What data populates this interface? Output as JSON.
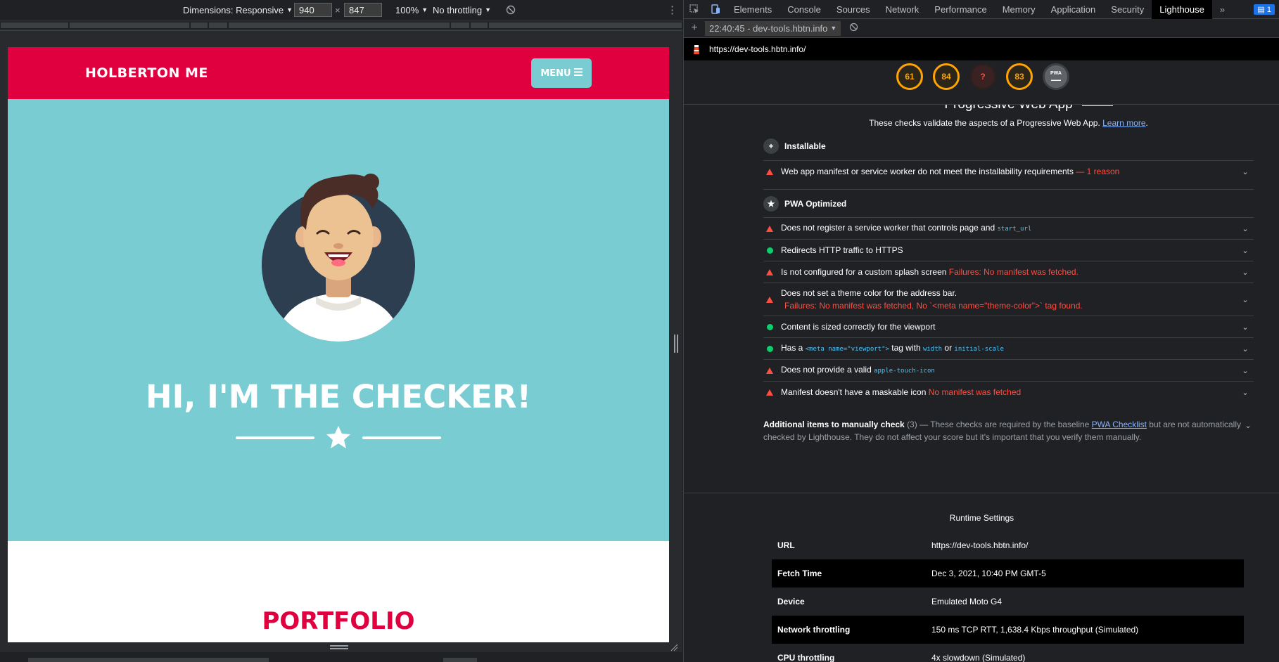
{
  "device_toolbar": {
    "dimensions_label": "Dimensions: Responsive",
    "width": "940",
    "height": "847",
    "times": "×",
    "zoom": "100%",
    "throttling": "No throttling"
  },
  "site": {
    "brand": "HOLBERTON ME",
    "menu_label": "MENU",
    "hero_title": "HI, I'M THE CHECKER!",
    "section_title": "PORTFOLIO"
  },
  "devtools": {
    "tabs": [
      "Elements",
      "Console",
      "Sources",
      "Network",
      "Performance",
      "Memory",
      "Application",
      "Security",
      "Lighthouse"
    ],
    "active_tab": "Lighthouse",
    "issues_count": "1",
    "report_selector": "22:40:45 - dev-tools.hbtn.info",
    "url": "https://dev-tools.hbtn.info/"
  },
  "scores": [
    {
      "label": "61",
      "kind": "average"
    },
    {
      "label": "84",
      "kind": "average"
    },
    {
      "label": "?",
      "kind": "error"
    },
    {
      "label": "83",
      "kind": "average"
    },
    {
      "label": "PWA",
      "kind": "pwa"
    }
  ],
  "pwa": {
    "title": "Progressive Web App",
    "description": "These checks validate the aspects of a Progressive Web App.",
    "learn_more": "Learn more",
    "installable": {
      "title": "Installable",
      "audits": [
        {
          "status": "fail",
          "text": "Web app manifest or service worker do not meet the installability requirements",
          "extra": "— 1 reason"
        }
      ]
    },
    "optimized": {
      "title": "PWA Optimized",
      "audits": [
        {
          "status": "fail",
          "text": "Does not register a service worker that controls page and",
          "code": "start_url"
        },
        {
          "status": "pass",
          "text": "Redirects HTTP traffic to HTTPS"
        },
        {
          "status": "fail",
          "text": "Is not configured for a custom splash screen",
          "extra": "Failures: No manifest was fetched."
        },
        {
          "status": "fail",
          "text": "Does not set a theme color for the address bar.",
          "extra": "Failures: No manifest was fetched, No `<meta name=\"theme-color\">` tag found."
        },
        {
          "status": "pass",
          "text": "Content is sized correctly for the viewport"
        },
        {
          "status": "pass",
          "text_a": "Has a",
          "code_a": "<meta name=\"viewport\">",
          "text_b": "tag with",
          "code_b": "width",
          "text_c": "or",
          "code_c": "initial-scale"
        },
        {
          "status": "fail",
          "text": "Does not provide a valid",
          "code": "apple-touch-icon"
        },
        {
          "status": "fail",
          "text": "Manifest doesn't have a maskable icon",
          "extra": "No manifest was fetched"
        }
      ]
    },
    "manual": {
      "title": "Additional items to manually check",
      "count": "(3)",
      "text_a": "— These checks are required by the baseline",
      "link": "PWA Checklist",
      "text_b": "but are not automatically checked by Lighthouse. They do not affect your score but it's important that you verify them manually."
    }
  },
  "runtime": {
    "title": "Runtime Settings",
    "rows": [
      {
        "key": "URL",
        "value": "https://dev-tools.hbtn.info/"
      },
      {
        "key": "Fetch Time",
        "value": "Dec 3, 2021, 10:40 PM GMT-5"
      },
      {
        "key": "Device",
        "value": "Emulated Moto G4"
      },
      {
        "key": "Network throttling",
        "value": "150 ms TCP RTT, 1,638.4 Kbps throughput (Simulated)"
      },
      {
        "key": "CPU throttling",
        "value": "4x slowdown (Simulated)"
      }
    ]
  },
  "colors": {
    "brand_red": "#e1003f",
    "hero_teal": "#79cdd2",
    "fail_red": "#ff4e42",
    "pass_green": "#0cce6b",
    "average_orange": "#ffa400"
  }
}
